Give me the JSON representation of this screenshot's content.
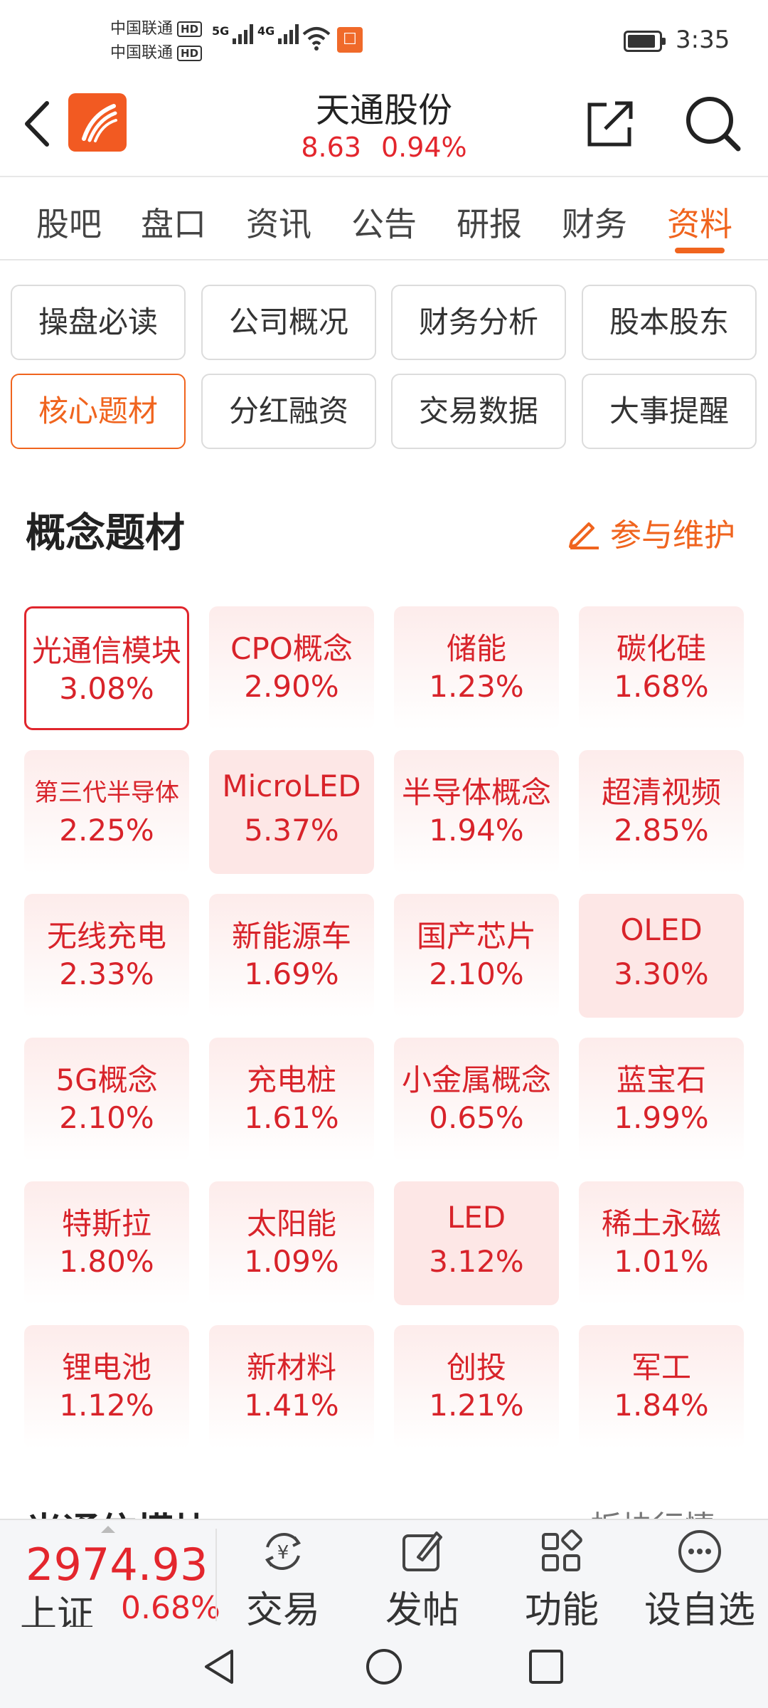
{
  "status_bar": {
    "carrier_1": "中国联通",
    "carrier_2": "中国联通",
    "hd": "HD",
    "net_1": "5G",
    "net_2": "4G",
    "time": "3:35"
  },
  "header": {
    "title": "天通股份",
    "price": "8.63",
    "change_pct": "0.94%"
  },
  "tabs": [
    {
      "label": "股吧"
    },
    {
      "label": "盘口"
    },
    {
      "label": "资讯"
    },
    {
      "label": "公告"
    },
    {
      "label": "研报"
    },
    {
      "label": "财务"
    },
    {
      "label": "资料",
      "active": true
    }
  ],
  "sub_buttons": [
    {
      "label": "操盘必读"
    },
    {
      "label": "公司概况"
    },
    {
      "label": "财务分析"
    },
    {
      "label": "股本股东"
    },
    {
      "label": "核心题材",
      "active": true
    },
    {
      "label": "分红融资"
    },
    {
      "label": "交易数据"
    },
    {
      "label": "大事提醒"
    }
  ],
  "concepts_section": {
    "title": "概念题材",
    "maintain_label": "参与维护",
    "items": [
      {
        "name": "光通信模块",
        "pct": "3.08%"
      },
      {
        "name": "CPO概念",
        "pct": "2.90%"
      },
      {
        "name": "储能",
        "pct": "1.23%"
      },
      {
        "name": "碳化硅",
        "pct": "1.68%"
      },
      {
        "name": "第三代半导体",
        "pct": "2.25%"
      },
      {
        "name": "MicroLED",
        "pct": "5.37%"
      },
      {
        "name": "半导体概念",
        "pct": "1.94%"
      },
      {
        "name": "超清视频",
        "pct": "2.85%"
      },
      {
        "name": "无线充电",
        "pct": "2.33%"
      },
      {
        "name": "新能源车",
        "pct": "1.69%"
      },
      {
        "name": "国产芯片",
        "pct": "2.10%"
      },
      {
        "name": "OLED",
        "pct": "3.30%"
      },
      {
        "name": "5G概念",
        "pct": "2.10%"
      },
      {
        "name": "充电桩",
        "pct": "1.61%"
      },
      {
        "name": "小金属概念",
        "pct": "0.65%"
      },
      {
        "name": "蓝宝石",
        "pct": "1.99%"
      },
      {
        "name": "特斯拉",
        "pct": "1.80%"
      },
      {
        "name": "太阳能",
        "pct": "1.09%"
      },
      {
        "name": "LED",
        "pct": "3.12%"
      },
      {
        "name": "稀土永磁",
        "pct": "1.01%"
      },
      {
        "name": "锂电池",
        "pct": "1.12%"
      },
      {
        "name": "新材料",
        "pct": "1.41%"
      },
      {
        "name": "创投",
        "pct": "1.21%"
      },
      {
        "name": "军工",
        "pct": "1.84%"
      }
    ]
  },
  "next_section": {
    "title": "光通信模块",
    "link": "板块行情 >"
  },
  "bottom_bar": {
    "index_value": "2974.93",
    "index_name": "上证",
    "index_pct": "0.68%",
    "nav": [
      {
        "label": "交易"
      },
      {
        "label": "发帖"
      },
      {
        "label": "功能"
      },
      {
        "label": "设自选"
      }
    ]
  },
  "colors": {
    "accent": "#f0641e",
    "up": "#e3262d"
  }
}
